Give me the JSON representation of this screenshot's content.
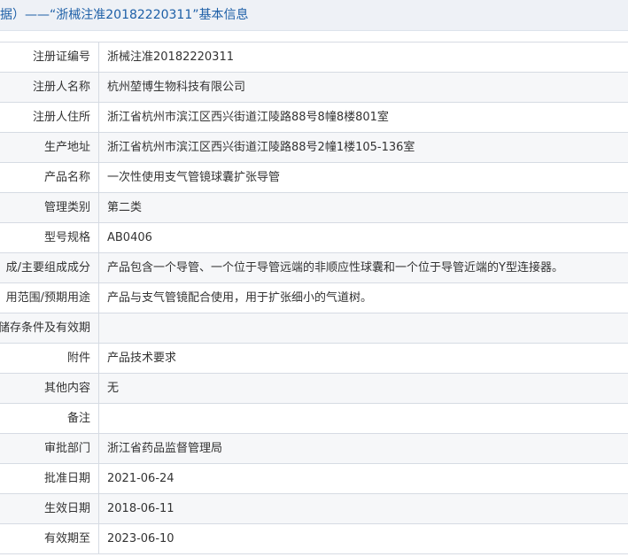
{
  "header": {
    "title": "据）——“浙械注准20182220311”基本信息"
  },
  "fields": [
    {
      "label": "注册证编号",
      "value": "浙械注准20182220311"
    },
    {
      "label": "注册人名称",
      "value": "杭州堃博生物科技有限公司"
    },
    {
      "label": "注册人住所",
      "value": "浙江省杭州市滨江区西兴街道江陵路88号8幢8楼801室"
    },
    {
      "label": "生产地址",
      "value": "浙江省杭州市滨江区西兴街道江陵路88号2幢1楼105-136室"
    },
    {
      "label": "产品名称",
      "value": "一次性使用支气管镜球囊扩张导管"
    },
    {
      "label": "管理类别",
      "value": "第二类"
    },
    {
      "label": "型号规格",
      "value": "AB0406"
    },
    {
      "label": "成/主要组成成分",
      "value": "产品包含一个导管、一个位于导管远端的非顺应性球囊和一个位于导管近端的Y型连接器。"
    },
    {
      "label": "用范围/预期用途",
      "value": "产品与支气管镜配合使用，用于扩张细小的气道树。"
    },
    {
      "label": "储存条件及有效期",
      "value": ""
    },
    {
      "label": "附件",
      "value": "产品技术要求"
    },
    {
      "label": "其他内容",
      "value": "无"
    },
    {
      "label": "备注",
      "value": ""
    },
    {
      "label": "审批部门",
      "value": "浙江省药品监督管理局"
    },
    {
      "label": "批准日期",
      "value": "2021-06-24"
    },
    {
      "label": "生效日期",
      "value": "2018-06-11"
    },
    {
      "label": "有效期至",
      "value": "2023-06-10"
    }
  ]
}
